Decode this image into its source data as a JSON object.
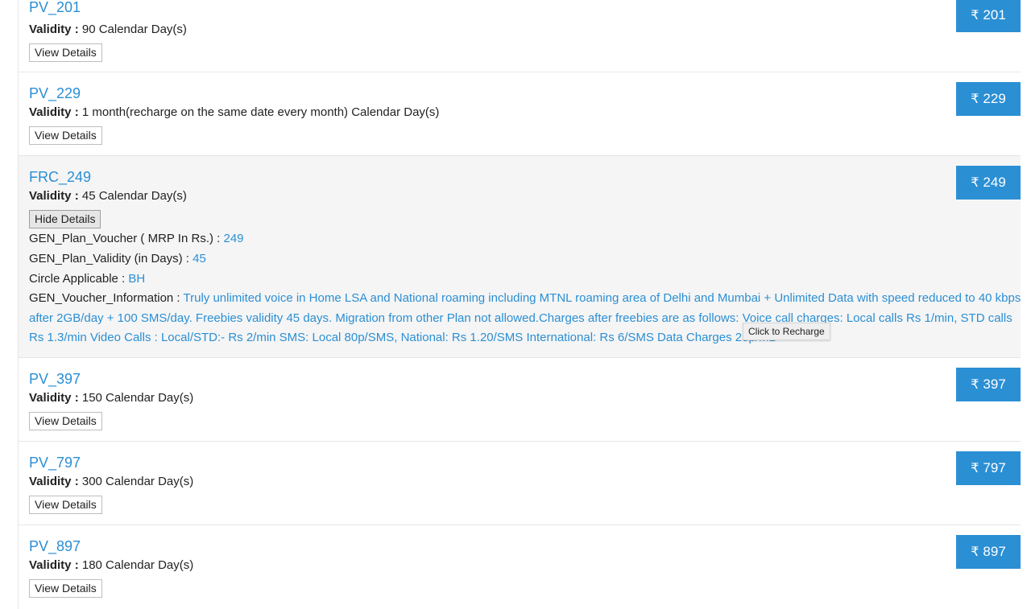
{
  "plans": [
    {
      "name": "PV_201",
      "validity_label": "Validity :",
      "validity": "90 Calendar Day(s)",
      "button": "View Details",
      "price": "201"
    },
    {
      "name": "PV_229",
      "validity_label": "Validity :",
      "validity": "1 month(recharge on the same date every month) Calendar Day(s)",
      "button": "View Details",
      "price": "229"
    },
    {
      "name": "FRC_249",
      "validity_label": "Validity :",
      "validity": "45 Calendar Day(s)",
      "button": "Hide Details",
      "price": "249",
      "details": {
        "mrp_label": "GEN_Plan_Voucher ( MRP In Rs.) :",
        "mrp": "249",
        "validity_label": "GEN_Plan_Validity (in Days) :",
        "validity_days": "45",
        "circle_label": "Circle Applicable :",
        "circle": "BH",
        "info_label": "GEN_Voucher_Information :",
        "info": "Truly unlimited voice in Home LSA and National roaming including MTNL roaming area of Delhi and Mumbai + Unlimited Data with speed reduced to 40 kbps after 2GB/day + 100 SMS/day. Freebies validity 45 days. Migration from other Plan not allowed.Charges after freebies are as follows: Voice call charges: Local calls Rs 1/min, STD calls Rs 1.3/min Video Calls : Local/STD:- Rs 2/min SMS: Local 80p/SMS, National: Rs 1.20/SMS International: Rs 6/SMS Data Charges 25p/MB"
      }
    },
    {
      "name": "PV_397",
      "validity_label": "Validity :",
      "validity": "150 Calendar Day(s)",
      "button": "View Details",
      "price": "397"
    },
    {
      "name": "PV_797",
      "validity_label": "Validity :",
      "validity": "300 Calendar Day(s)",
      "button": "View Details",
      "price": "797"
    },
    {
      "name": "PV_897",
      "validity_label": "Validity :",
      "validity": "180 Calendar Day(s)",
      "button": "View Details",
      "price": "897"
    }
  ],
  "currency_symbol": "₹",
  "tooltip": "Click to Recharge",
  "colors": {
    "accent": "#2b8fd4",
    "expanded_bg": "#f5f5f5"
  }
}
